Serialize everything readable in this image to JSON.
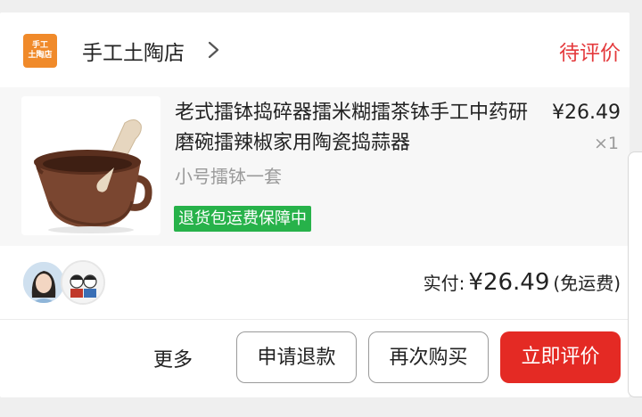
{
  "shop": {
    "logo_line1": "手工",
    "logo_line2": "土陶店",
    "name": "手工土陶店",
    "status": "待评价"
  },
  "product": {
    "title": "老式擂钵捣碎器擂米糊擂茶钵手工中药研磨碗擂辣椒家用陶瓷捣蒜器",
    "spec": "小号擂钵一套",
    "badge": "退货包运费保障中",
    "price": "¥26.49",
    "quantity": "×1"
  },
  "payment": {
    "label": "实付:",
    "amount": "¥26.49",
    "shipping_note": "(免运费)"
  },
  "actions": {
    "more": "更多",
    "refund": "申请退款",
    "rebuy": "再次购买",
    "review": "立即评价"
  },
  "colors": {
    "accent": "#e42a24",
    "status": "#e4393c",
    "badge": "#27b24a",
    "logo": "#f08a2a"
  }
}
